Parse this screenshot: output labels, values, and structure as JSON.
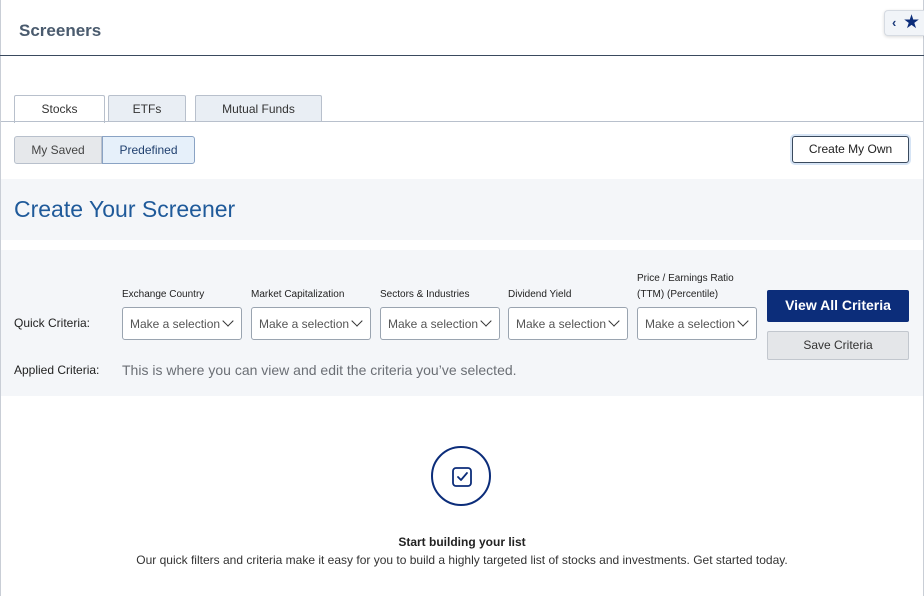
{
  "header": {
    "title": "Screeners"
  },
  "favorites": {
    "chevron_icon": "chevron-left-icon",
    "star_icon": "star-icon"
  },
  "tabs": [
    {
      "label": "Stocks",
      "active": true
    },
    {
      "label": "ETFs",
      "active": false
    },
    {
      "label": "Mutual Funds",
      "active": false
    }
  ],
  "segment": {
    "left_label": "My Saved",
    "right_label": "Predefined",
    "selected": "Predefined"
  },
  "create_own_label": "Create My Own",
  "section_title": "Create Your Screener",
  "quick_criteria": {
    "label": "Quick Criteria:",
    "items": [
      {
        "label": "Exchange Country",
        "value": "Make a selection"
      },
      {
        "label": "Market Capitalization",
        "value": "Make a selection"
      },
      {
        "label": "Sectors & Industries",
        "value": "Make a selection"
      },
      {
        "label": "Dividend Yield",
        "value": "Make a selection"
      },
      {
        "label": "Price / Earnings Ratio (TTM) (Percentile)",
        "value": "Make a selection"
      }
    ]
  },
  "applied_criteria": {
    "label": "Applied Criteria:",
    "text": "This is where you can view and edit the criteria you’ve selected."
  },
  "buttons": {
    "view_all": "View All Criteria",
    "save": "Save Criteria"
  },
  "empty_state": {
    "icon": "checkbox-icon",
    "title": "Start building your list",
    "description": "Our quick filters and criteria make it easy for you to build a highly targeted list of stocks and investments. Get started today."
  },
  "colors": {
    "primary": "#0c2d7a",
    "title_blue": "#1f5a9a",
    "band_bg": "#f4f6f9"
  }
}
